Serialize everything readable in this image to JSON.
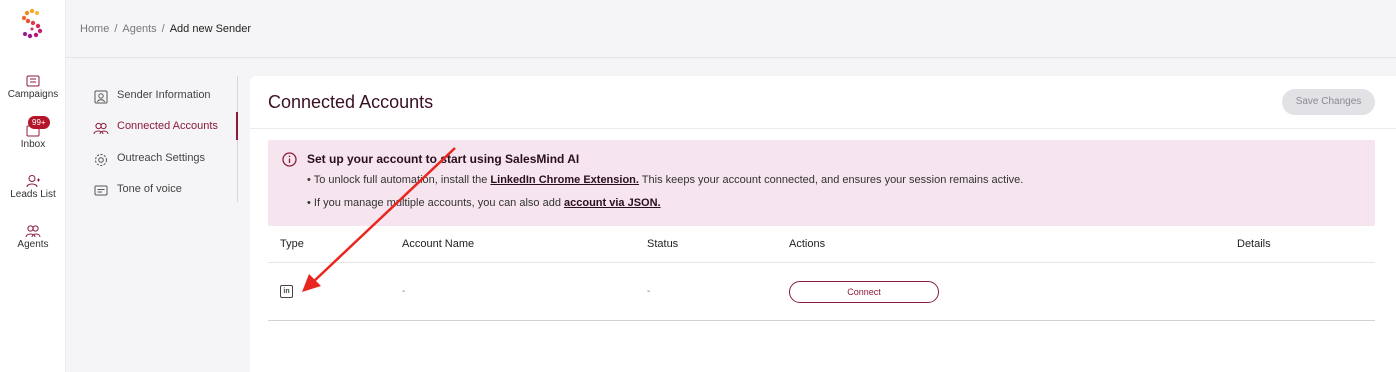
{
  "rail": {
    "items": [
      {
        "label": "Campaigns",
        "icon": "campaigns-icon"
      },
      {
        "label": "Inbox",
        "icon": "inbox-icon"
      },
      {
        "label": "Leads List",
        "icon": "add-user-icon"
      },
      {
        "label": "Agents",
        "icon": "agents-icon"
      }
    ],
    "inbox_badge": "99+"
  },
  "breadcrumb": {
    "items": [
      "Home",
      "Agents"
    ],
    "separator": "/",
    "current": "Add new Sender"
  },
  "settings_nav": {
    "items": [
      {
        "label": "Sender Information",
        "icon": "user-card-icon",
        "active": false
      },
      {
        "label": "Connected Accounts",
        "icon": "users-icon",
        "active": true
      },
      {
        "label": "Outreach Settings",
        "icon": "gear-icon",
        "active": false
      },
      {
        "label": "Tone of voice",
        "icon": "chat-icon",
        "active": false
      }
    ]
  },
  "card": {
    "title": "Connected Accounts",
    "save_label": "Save Changes"
  },
  "notice": {
    "title": "Set up your account to start using SalesMind AI",
    "line1_pre": "• To unlock full automation, install the ",
    "line1_link": "LinkedIn Chrome Extension.",
    "line1_post": " This keeps your account connected, and ensures your session remains active.",
    "line2_pre": "• If you manage multiple accounts, you can also add ",
    "line2_link": "account via JSON."
  },
  "table": {
    "columns": [
      "Type",
      "Account Name",
      "Status",
      "Actions",
      "Details"
    ],
    "rows": [
      {
        "type_icon": "linkedin-icon",
        "type_text": "in",
        "account_name": "-",
        "status": "-",
        "action_label": "Connect",
        "details": ""
      }
    ]
  },
  "colors": {
    "accent": "#8c1b3a",
    "notice_bg": "#f6e4ee",
    "badge": "#b5142b",
    "arrow": "#e8261f"
  }
}
